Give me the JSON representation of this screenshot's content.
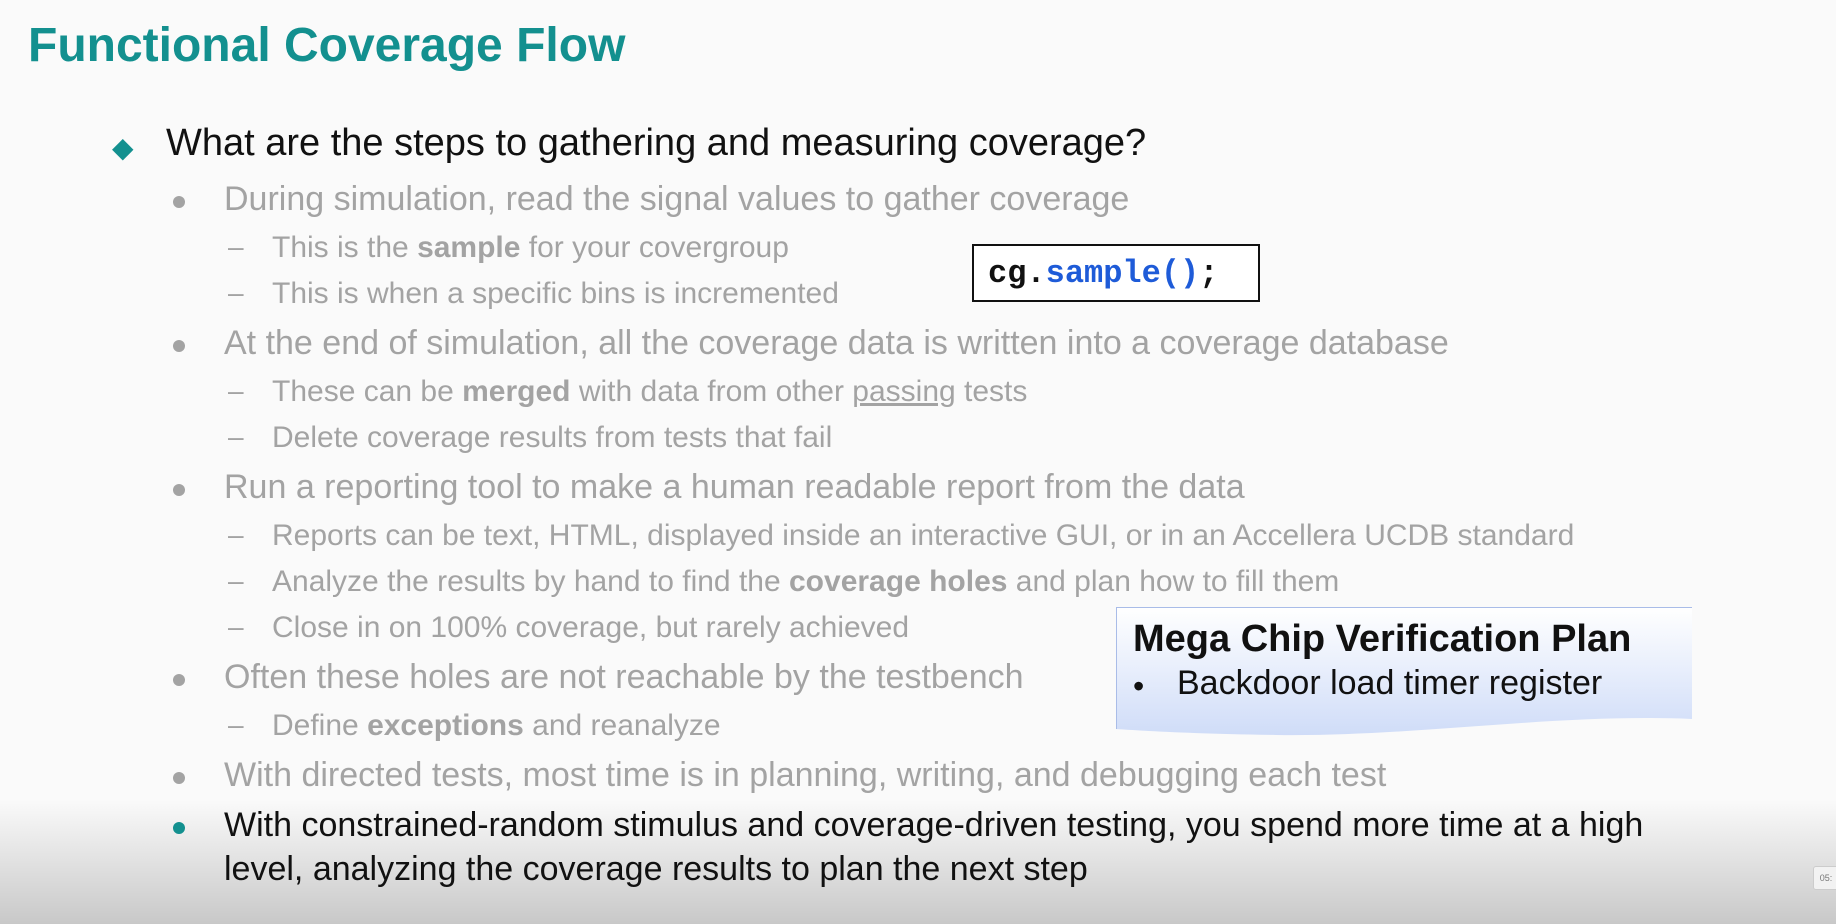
{
  "title": "Functional Coverage Flow",
  "question": "What are the steps to gathering and measuring coverage?",
  "bullets": {
    "b1": "During simulation, read the signal values to gather coverage",
    "b1_s1_pre": "This is the ",
    "b1_s1_bold": "sample",
    "b1_s1_post": " for your covergroup",
    "b1_s2": "This is when a specific bins is incremented",
    "b2": "At the end of simulation, all the coverage data is written into a coverage database",
    "b2_s1_pre": "These can be ",
    "b2_s1_bold": "merged",
    "b2_s1_mid": " with data from other ",
    "b2_s1_ul": "passing",
    "b2_s1_post": " tests",
    "b2_s2": "Delete coverage results from tests that fail",
    "b3": "Run a reporting tool to make a human readable report from the data",
    "b3_s1": "Reports can be text, HTML, displayed inside an interactive GUI, or in an Accellera UCDB standard",
    "b3_s2_pre": "Analyze the results by hand to find the ",
    "b3_s2_bold": "coverage holes",
    "b3_s2_post": " and plan how to fill them",
    "b3_s3": "Close in on 100% coverage, but rarely achieved",
    "b4": "Often these holes are not reachable by the testbench",
    "b4_s1_pre": "Define ",
    "b4_s1_bold": "exceptions",
    "b4_s1_post": " and reanalyze",
    "b5": "With directed tests, most time is in planning, writing, and debugging each test",
    "b6_l1": "With constrained-random stimulus and coverage-driven testing, you spend more time at a high",
    "b6_l2": "level, analyzing the coverage results to plan the next step"
  },
  "code": {
    "obj": "cg.",
    "call": "sample()",
    "end": ";"
  },
  "plan": {
    "title": "Mega Chip Verification Plan",
    "item": "Backdoor load timer register"
  },
  "timestamp": "05:",
  "colors": {
    "accent": "#13908f",
    "muted": "#a3a3a3",
    "code_call": "#1e5bd8"
  },
  "icons": {
    "level0": "diamond-bullet-icon",
    "level1": "dot-bullet-icon",
    "level2": "dash-bullet-icon"
  }
}
